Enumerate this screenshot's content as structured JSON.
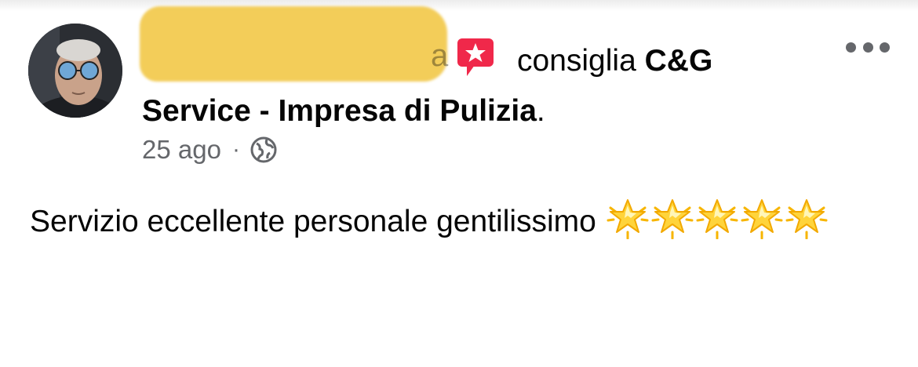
{
  "post": {
    "author_visible_suffix": "a",
    "action_text": "consiglia",
    "page_name_line1": "C&G",
    "page_name_line2": "Service - Impresa di Pulizia",
    "trailing_punct": ".",
    "timestamp": "25 ago",
    "separator": "·",
    "audience_icon": "globe-icon",
    "recommendation_icon": "recommend-star-icon",
    "review_text": "Servizio eccellente personale gentilissimo",
    "star_emoji_count": 5
  },
  "colors": {
    "text_primary": "#050505",
    "text_secondary": "#65676b",
    "redaction": "#f2c94c",
    "recommend_red": "#f0284a"
  }
}
